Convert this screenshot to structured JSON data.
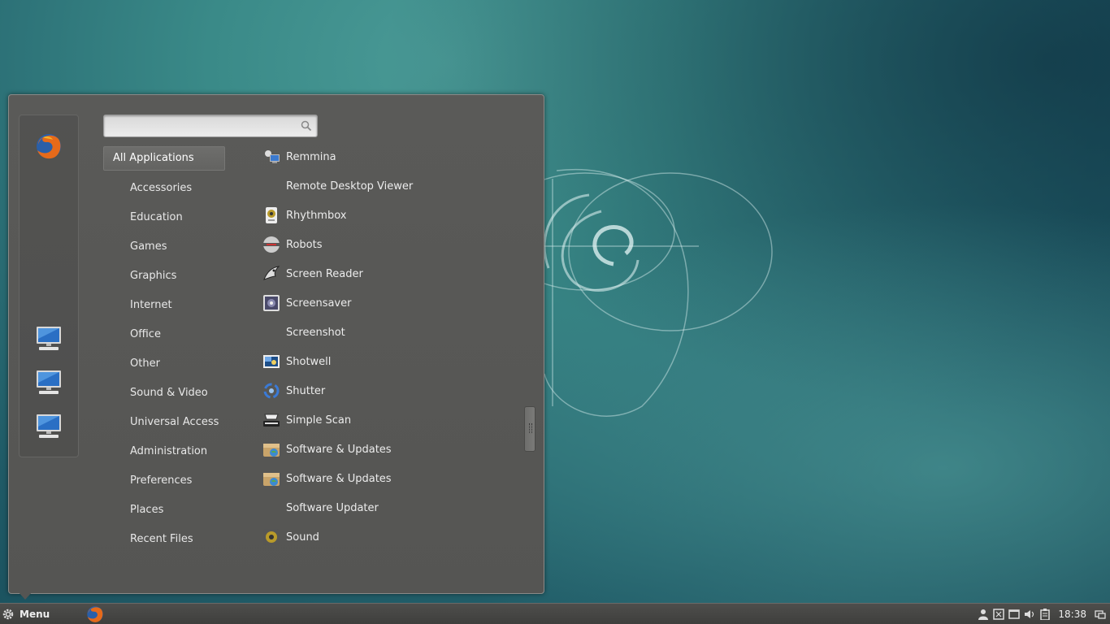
{
  "search": {
    "placeholder": "",
    "value": ""
  },
  "categories": [
    {
      "label": "All Applications",
      "active": true
    },
    {
      "label": "Accessories"
    },
    {
      "label": "Education"
    },
    {
      "label": "Games"
    },
    {
      "label": "Graphics"
    },
    {
      "label": "Internet"
    },
    {
      "label": "Office"
    },
    {
      "label": "Other"
    },
    {
      "label": "Sound & Video"
    },
    {
      "label": "Universal Access"
    },
    {
      "label": "Administration"
    },
    {
      "label": "Preferences"
    },
    {
      "label": "Places"
    },
    {
      "label": "Recent Files"
    }
  ],
  "apps": [
    {
      "label": "Remmina",
      "icon": "remmina-icon"
    },
    {
      "label": "Remote Desktop Viewer",
      "icon": ""
    },
    {
      "label": "Rhythmbox",
      "icon": "rhythmbox-icon"
    },
    {
      "label": "Robots",
      "icon": "robots-icon"
    },
    {
      "label": "Screen Reader",
      "icon": "screen-reader-icon"
    },
    {
      "label": "Screensaver",
      "icon": "screensaver-icon"
    },
    {
      "label": "Screenshot",
      "icon": ""
    },
    {
      "label": "Shotwell",
      "icon": "shotwell-icon"
    },
    {
      "label": "Shutter",
      "icon": "shutter-icon"
    },
    {
      "label": "Simple Scan",
      "icon": "scanner-icon"
    },
    {
      "label": "Software & Updates",
      "icon": "software-updates-icon"
    },
    {
      "label": "Software & Updates",
      "icon": "software-updates-icon"
    },
    {
      "label": "Software Updater",
      "icon": ""
    },
    {
      "label": "Sound",
      "icon": "sound-icon"
    }
  ],
  "favorites": [
    {
      "icon": "firefox-icon"
    },
    {
      "icon": "computer-icon"
    },
    {
      "icon": "computer-icon"
    },
    {
      "icon": "computer-icon"
    }
  ],
  "panel": {
    "menu_label": "Menu",
    "clock": "18:38"
  }
}
